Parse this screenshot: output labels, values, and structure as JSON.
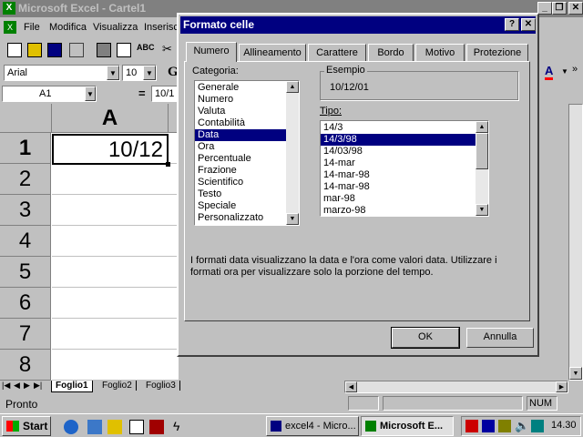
{
  "app": {
    "title": "Microsoft Excel - Cartel1"
  },
  "menu": [
    "File",
    "Modifica",
    "Visualizza",
    "Inserisc"
  ],
  "formatting": {
    "font": "Arial",
    "size": "10"
  },
  "formula": {
    "cell_ref": "A1",
    "equals": "=",
    "value": "10/1"
  },
  "sheet": {
    "col_header": "A",
    "rows": [
      "1",
      "2",
      "3",
      "4",
      "5",
      "6",
      "7",
      "8"
    ],
    "a1_value": "10/12",
    "tabs": [
      "Foglio1",
      "Foglio2",
      "Foglio3"
    ]
  },
  "status": {
    "ready": "Pronto",
    "num": "NUM"
  },
  "dialog": {
    "title": "Formato celle",
    "help": "?",
    "close": "✕",
    "tabs": [
      "Numero",
      "Allineamento",
      "Carattere",
      "Bordo",
      "Motivo",
      "Protezione"
    ],
    "category_label": "Categoria:",
    "categories": [
      "Generale",
      "Numero",
      "Valuta",
      "Contabilità",
      "Data",
      "Ora",
      "Percentuale",
      "Frazione",
      "Scientifico",
      "Testo",
      "Speciale",
      "Personalizzato"
    ],
    "selected_category": "Data",
    "sample_label": "Esempio",
    "sample_value": "10/12/01",
    "type_label": "Tipo:",
    "types": [
      "14/3",
      "14/3/98",
      "14/03/98",
      "14-mar",
      "14-mar-98",
      "14-mar-98",
      "mar-98",
      "marzo-98"
    ],
    "selected_type": "14/3/98",
    "description": "I formati data visualizzano la data e l'ora come valori data. Utilizzare i formati ora per visualizzare solo la porzione del tempo.",
    "ok": "OK",
    "cancel": "Annulla"
  },
  "taskbar": {
    "start": "Start",
    "tasks": [
      "excel4 - Micro...",
      "Microsoft E..."
    ],
    "clock": "14.30"
  },
  "colors": {
    "title_active": "#000080",
    "title_inactive": "#808080",
    "face": "#c0c0c0",
    "font_color_bar": "#ff0000"
  }
}
